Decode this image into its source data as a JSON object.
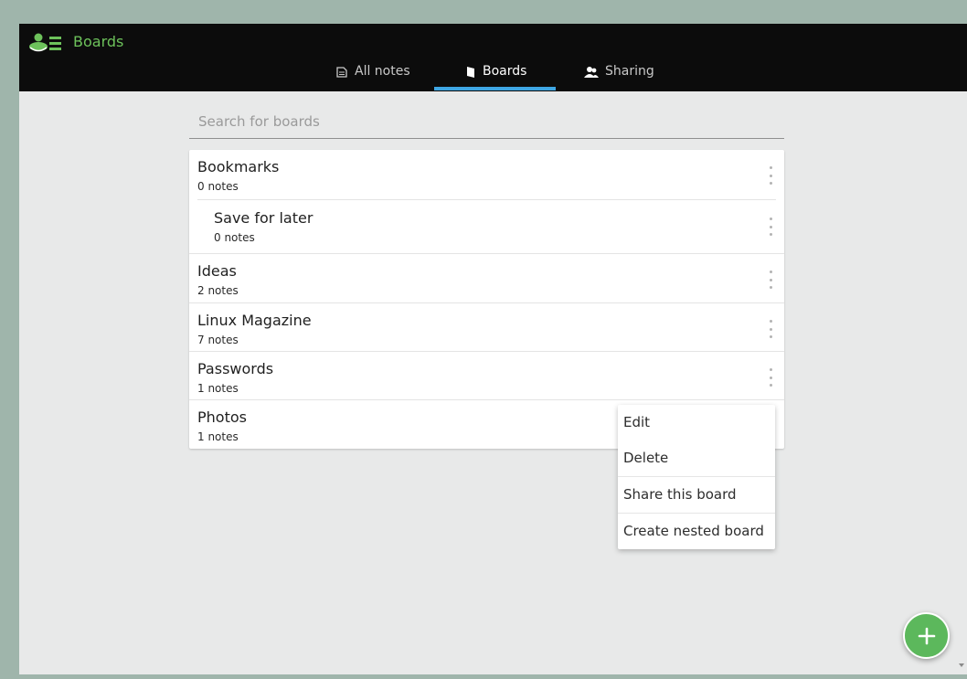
{
  "app": {
    "title": "Boards",
    "accent_color": "#6dc25b",
    "tab_indicator_color": "#3ea6e3"
  },
  "tabs": [
    {
      "label": "All notes",
      "icon": "notes-icon",
      "active": false
    },
    {
      "label": "Boards",
      "icon": "board-icon",
      "active": true
    },
    {
      "label": "Sharing",
      "icon": "users-icon",
      "active": false
    }
  ],
  "search": {
    "placeholder": "Search for boards",
    "value": ""
  },
  "boards": [
    {
      "name": "Bookmarks",
      "count": "0 notes",
      "nested": false
    },
    {
      "name": "Save for later",
      "count": "0 notes",
      "nested": true
    },
    {
      "name": "Ideas",
      "count": "2 notes",
      "nested": false
    },
    {
      "name": "Linux Magazine",
      "count": "7 notes",
      "nested": false
    },
    {
      "name": "Passwords",
      "count": "1 notes",
      "nested": false
    },
    {
      "name": "Photos",
      "count": "1 notes",
      "nested": false
    }
  ],
  "context_menu": {
    "items": [
      "Edit",
      "Delete",
      "Share this board",
      "Create nested board"
    ]
  },
  "fab": {
    "icon": "plus-icon",
    "color": "#5cb85c"
  }
}
